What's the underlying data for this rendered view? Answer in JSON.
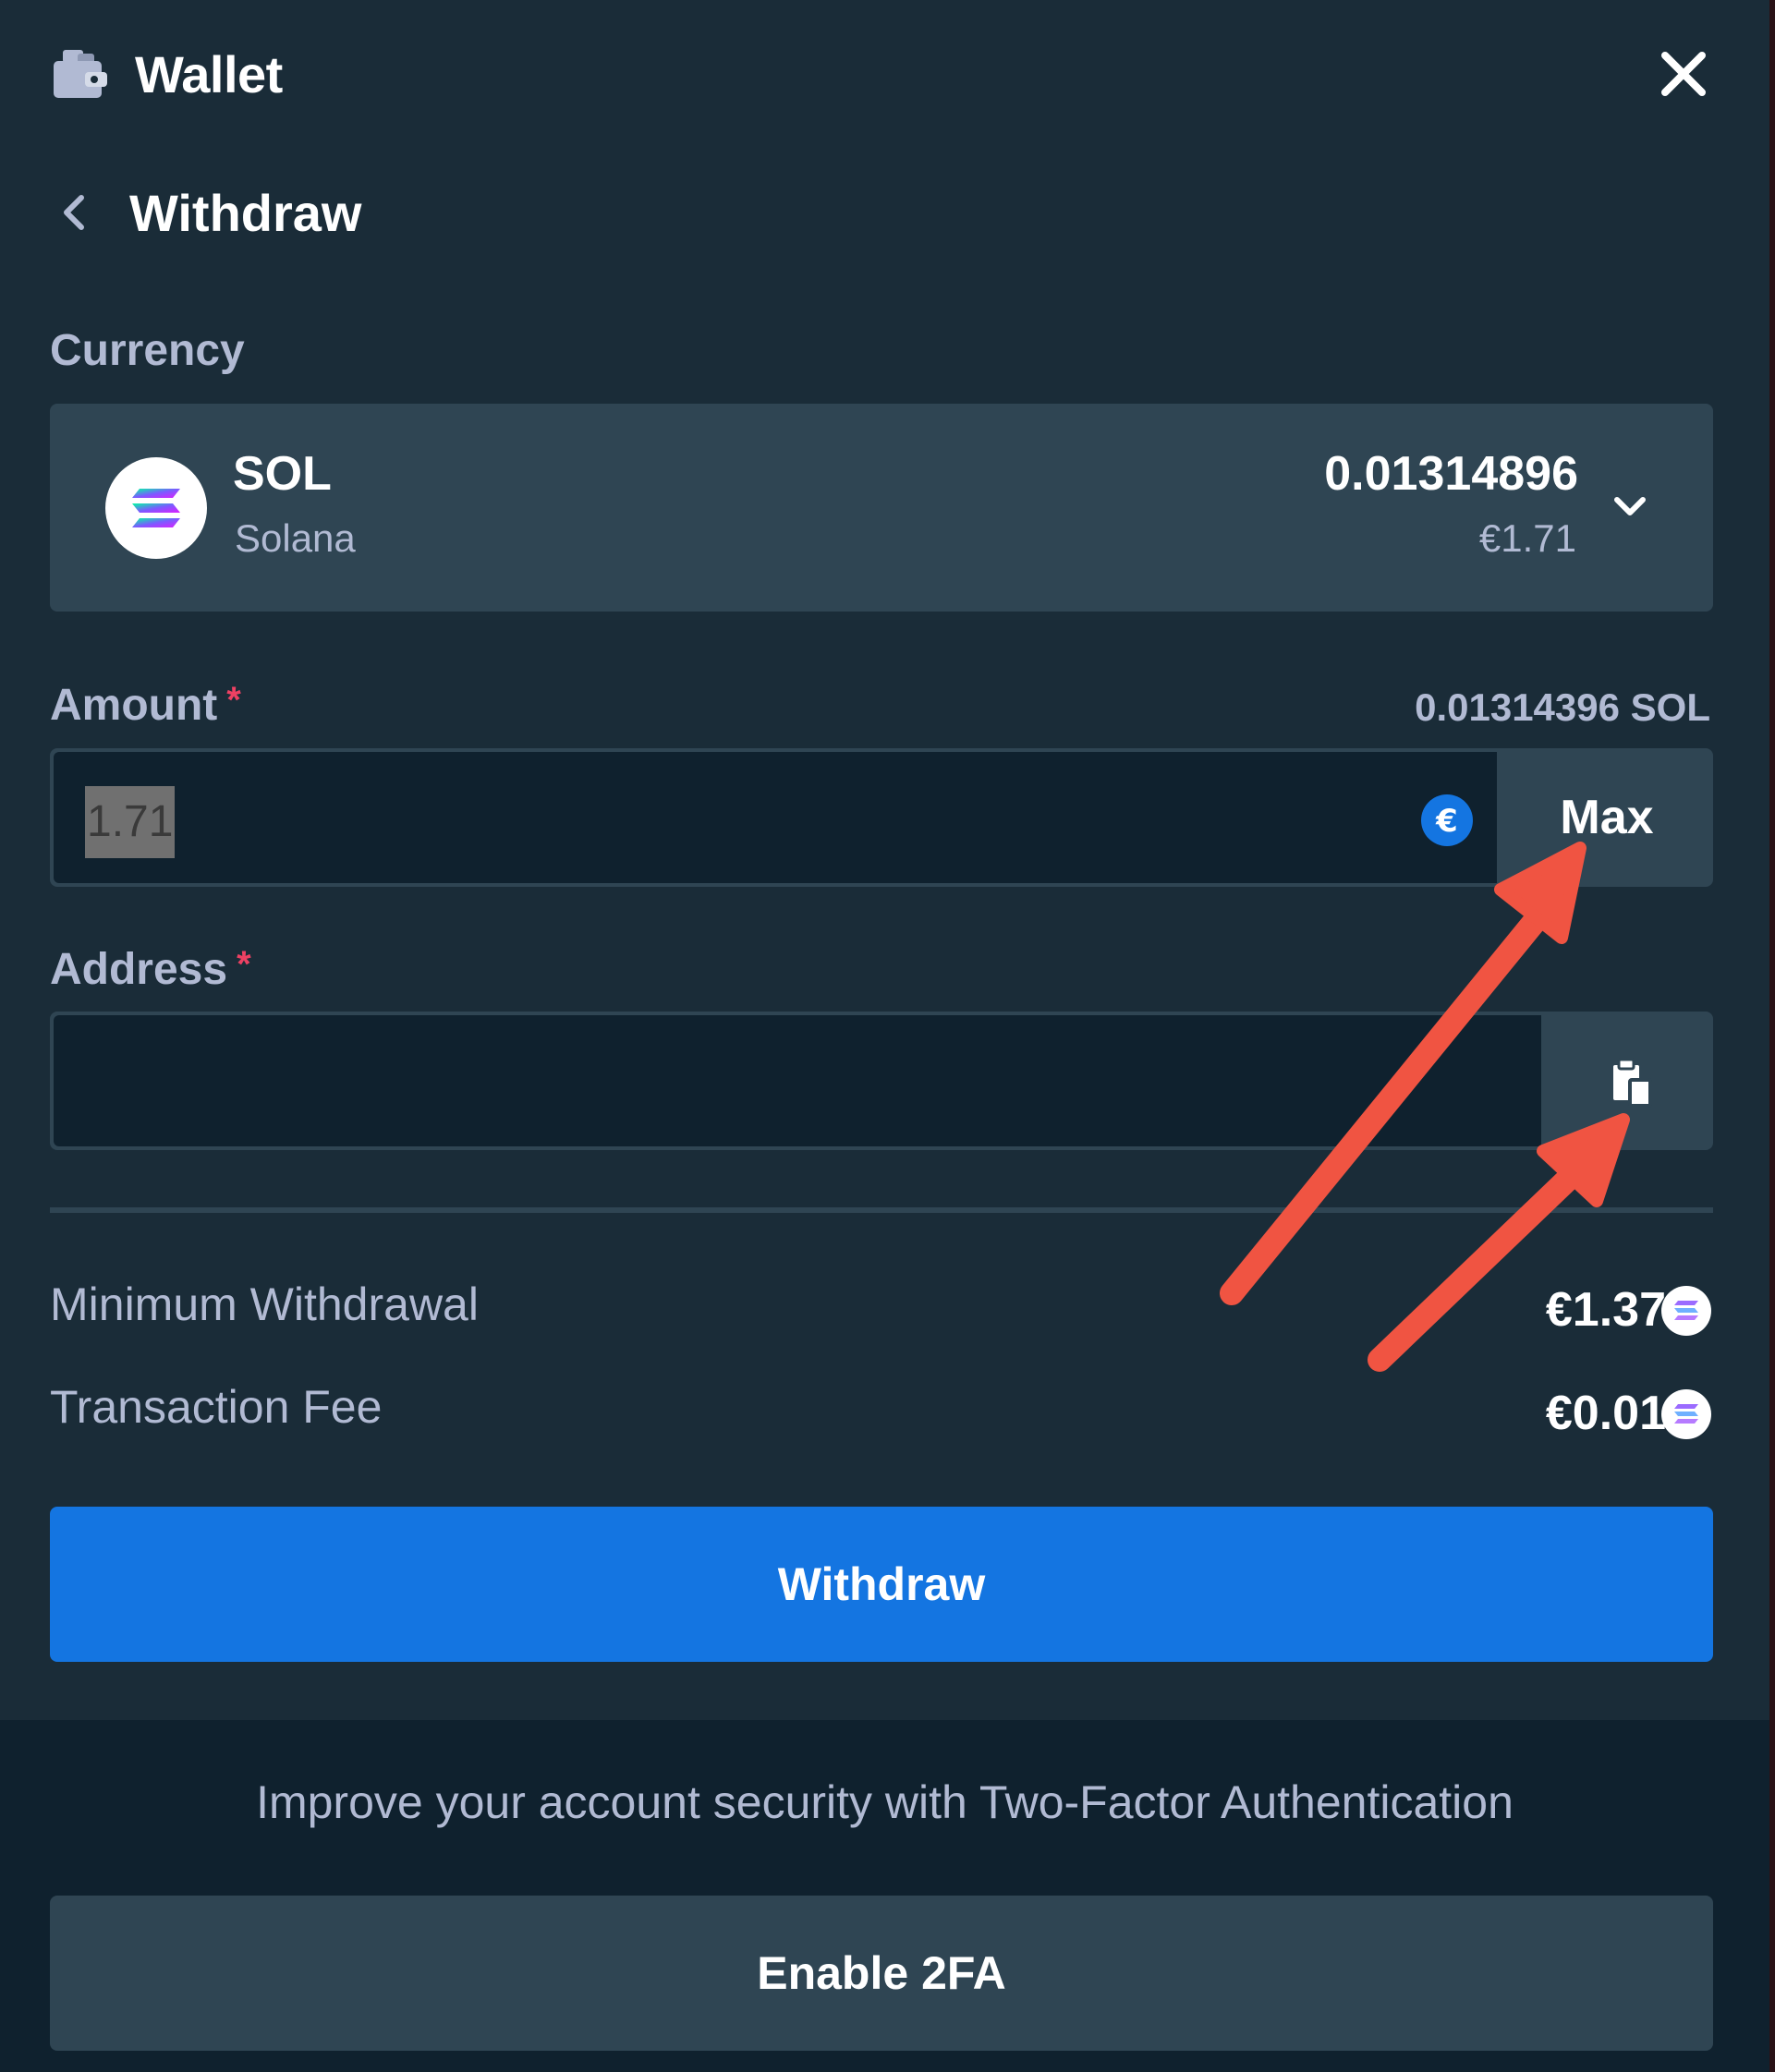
{
  "header": {
    "title": "Wallet",
    "icon": "wallet-icon",
    "close_icon": "close-icon"
  },
  "nav": {
    "back_icon": "chevron-left-icon",
    "title": "Withdraw"
  },
  "currency": {
    "label": "Currency",
    "code": "SOL",
    "name": "Solana",
    "balance": "0.01314896",
    "fiat": "€1.71",
    "icon": "solana-icon",
    "dropdown_icon": "chevron-down-icon"
  },
  "amount": {
    "label": "Amount",
    "required_mark": "*",
    "available": "0.01314396 SOL",
    "value": "1.71",
    "currency_icon": "euro-icon",
    "max_label": "Max"
  },
  "address": {
    "label": "Address",
    "required_mark": "*",
    "value": "",
    "paste_icon": "clipboard-icon"
  },
  "info": {
    "min_label": "Minimum Withdrawal",
    "min_value": "€1.37",
    "fee_label": "Transaction Fee",
    "fee_value": "€0.01"
  },
  "withdraw_button": "Withdraw",
  "footer": {
    "text": "Improve your account security with Two-Factor Authentication",
    "button": "Enable 2FA"
  },
  "colors": {
    "background": "#1a2c38",
    "input": "#0f212e",
    "surface": "#2f4553",
    "primary": "#1475e1",
    "muted_text": "#b1bad3",
    "required": "#ed4163",
    "annotation_arrow": "#f05442"
  }
}
